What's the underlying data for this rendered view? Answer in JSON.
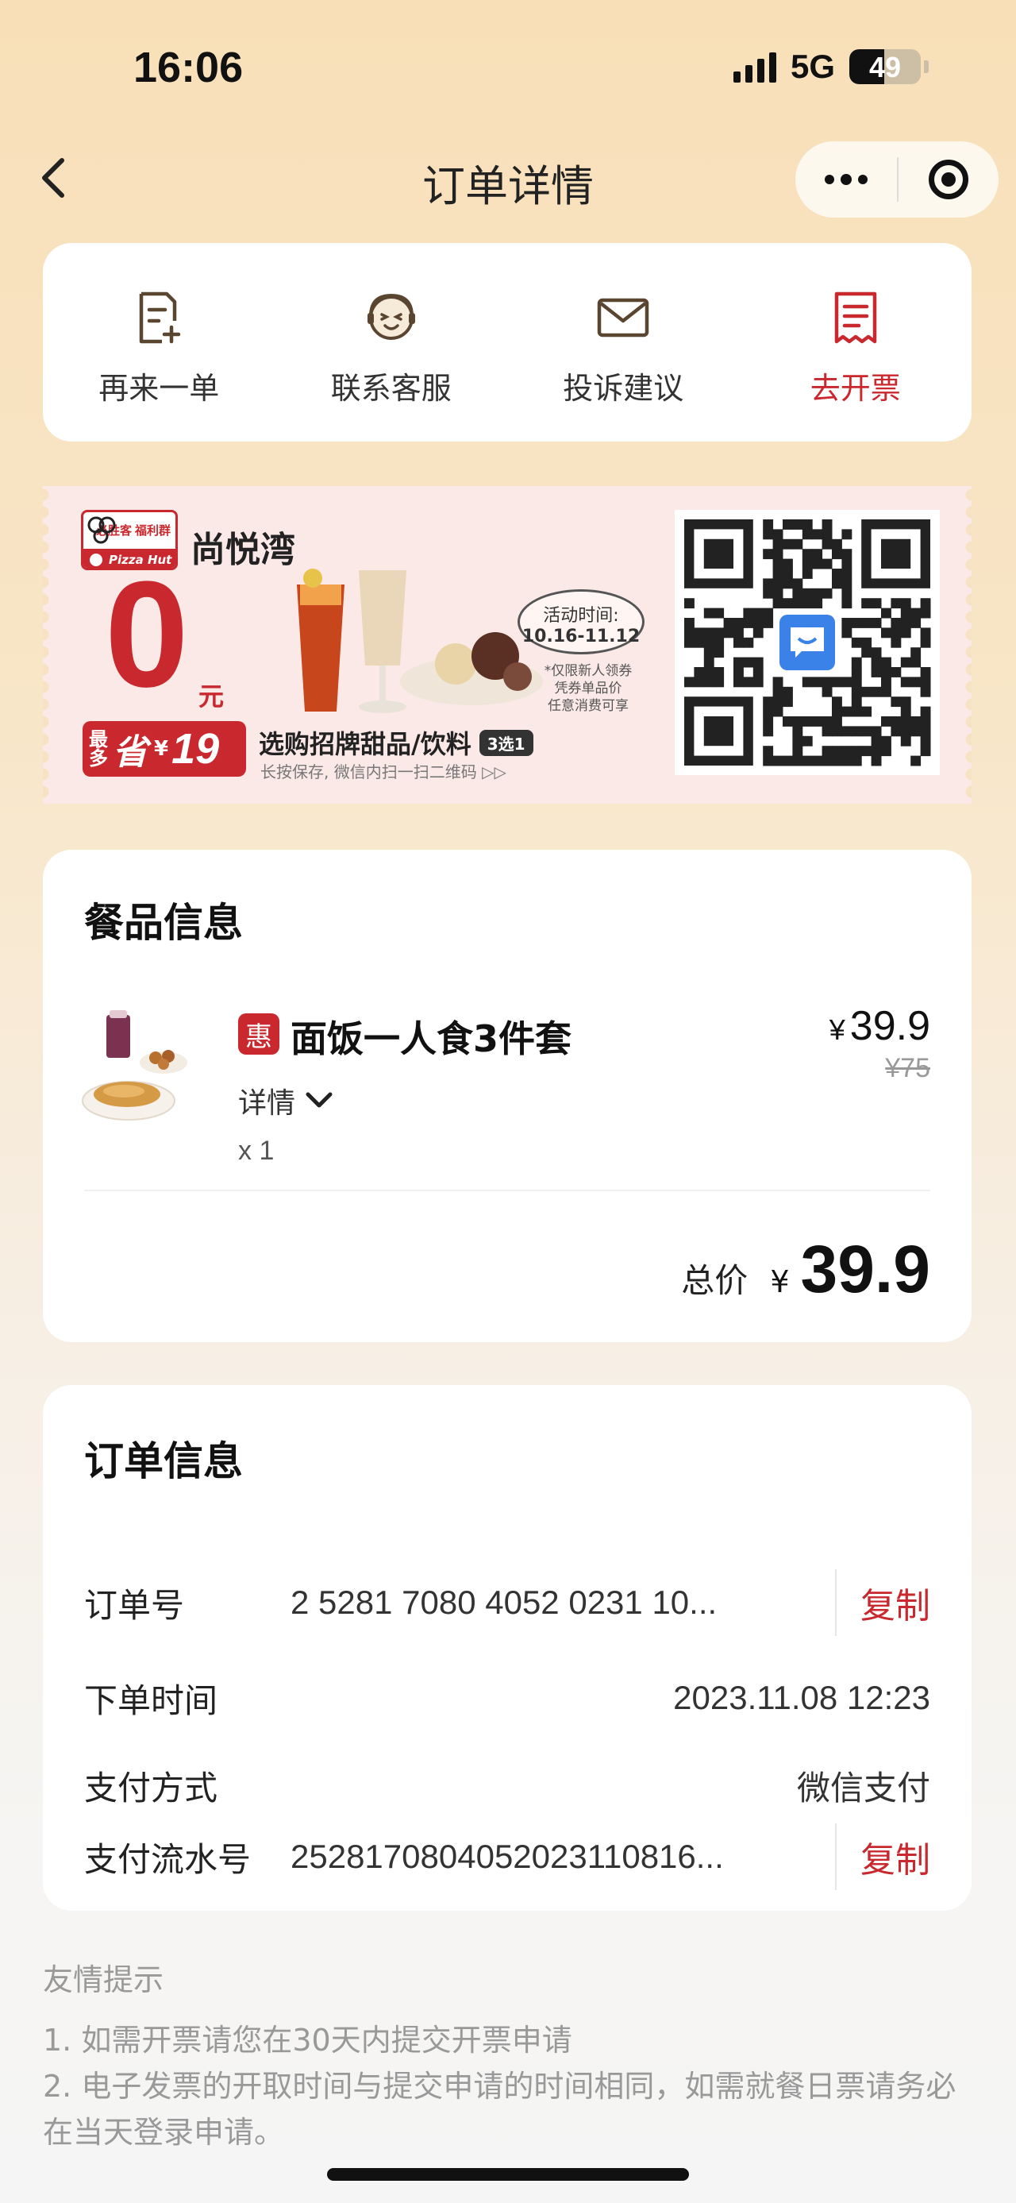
{
  "status_bar": {
    "time": "16:06",
    "network": "5G",
    "battery": "49",
    "battery_level": 0.49
  },
  "nav": {
    "title": "订单详情"
  },
  "actions": [
    {
      "label": "再来一单",
      "icon": "reorder-icon"
    },
    {
      "label": "联系客服",
      "icon": "customer-service-icon"
    },
    {
      "label": "投诉建议",
      "icon": "mail-icon"
    },
    {
      "label": "去开票",
      "icon": "invoice-icon"
    }
  ],
  "banner": {
    "brand": {
      "line1": "必胜客",
      "line2": "福利群",
      "wordmark": "Pizza Hut"
    },
    "store_name": "尚悦湾",
    "big_number": "0",
    "unit": "元",
    "save_prefix_1": "最",
    "save_prefix_2": "多",
    "save_word": "省",
    "save_currency": "¥",
    "save_amount": "19",
    "activity_label": "活动时间:",
    "activity_dates": "10.16-11.12",
    "notes": [
      "*仅限新人领券",
      "凭券单品价",
      "任意消费可享"
    ],
    "promo_text": "选购招牌甜品/饮料",
    "promo_tag": "3选1",
    "promo_sub": "长按保存, 微信内扫一扫二维码 ▷▷"
  },
  "food": {
    "title": "餐品信息",
    "item": {
      "tag": "惠",
      "name": "面饭一人食3件套",
      "detail_label": "详情",
      "qty": "x 1",
      "currency": "¥",
      "price": "39.9",
      "original_price": "¥75"
    },
    "total_label": "总价",
    "total_currency": "¥",
    "total_value": "39.9"
  },
  "order": {
    "title": "订单信息",
    "rows": [
      {
        "key": "订单号",
        "value": "2 5281 7080 4052 0231 10...",
        "copy": "复制"
      },
      {
        "key": "下单时间",
        "value": "2023.11.08 12:23"
      },
      {
        "key": "支付方式",
        "value": "微信支付"
      },
      {
        "key": "支付流水号",
        "value": "2528170804052023110816...",
        "copy": "复制"
      }
    ]
  },
  "tips": {
    "title": "友情提示",
    "lines": [
      "1. 如需开票请您在30天内提交开票申请",
      "2. 电子发票的开取时间与提交申请的时间相同，如需就餐日票请务必在当天登录申请。"
    ]
  },
  "colors": {
    "accent_red": "#c8282e",
    "page_bg_top": "#f8dfb8",
    "card_bg": "#ffffff"
  }
}
